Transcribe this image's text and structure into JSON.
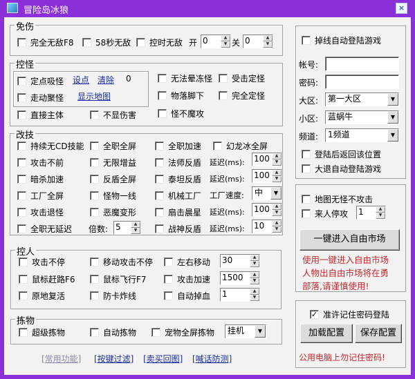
{
  "window": {
    "title": "冒险岛冰狼",
    "close": "×"
  },
  "mianshang": {
    "title": "免伤",
    "wudi": "完全无敌F8",
    "wudi58": "58秒无敌",
    "kongshi": "控时无敌",
    "kai": "开",
    "kai_value": "0",
    "guan": "关",
    "guan_value": "0"
  },
  "kongguai": {
    "title": "控怪",
    "dingdian": "定点吸怪",
    "shedian": "设点",
    "qingchu": "清除",
    "count": "0",
    "zoudong": "走动聚怪",
    "xianshi": "显示地图",
    "zhijie": "直接主体",
    "buxian": "不显伤害",
    "wufa": "无法晕冻怪",
    "shouji": "受击定怪",
    "wuluo": "物落脚下",
    "wanquan": "完全定怪",
    "guaibu": "怪不魔攻"
  },
  "gaiji": {
    "title": "改技",
    "c1": [
      "持续无CD技能",
      "攻击不前",
      "暗杀加速",
      "工厂全屏",
      "攻击退怪",
      "全职无延迟"
    ],
    "c2": [
      "全职全屏",
      "无限增益",
      "反盾全屏",
      "怪物一线",
      "恶魔变形"
    ],
    "beishu": "倍数:",
    "beishu_value": "5",
    "c3": [
      "全职加速",
      "法师反盾",
      "泰坦反盾",
      "机械工厂",
      "扇击晨星",
      "战神反盾"
    ],
    "huanlong": "幻龙冰全屏",
    "delay": "延迟(ms):",
    "factory_speed": "工厂速度:",
    "factory_speed_value": "中",
    "delays": [
      "100",
      "100",
      "100",
      "10"
    ]
  },
  "kongren": {
    "title": "控人",
    "c1": [
      "攻击不停",
      "鼠标赶路F6",
      "原地复活"
    ],
    "c2": [
      "移动攻击不停",
      "鼠标飞行F7",
      "防卡炸线"
    ],
    "c3": [
      "左右移动",
      "攻击加速",
      "自动掉血"
    ],
    "values": [
      "30",
      "1500",
      "1"
    ]
  },
  "jianwu": {
    "title": "拣物",
    "items": [
      "超级拣物",
      "自动拣物",
      "宠物全屏拣物"
    ],
    "mode": "挂机"
  },
  "bottom_links": [
    "[常用功能]",
    "[按键过滤]",
    "[卖买回图]",
    "[喊话防测]"
  ],
  "login": {
    "auto": "掉线自动登陆游戏",
    "account": "帐号:",
    "password": "密码:",
    "account_value": "",
    "password_value": "",
    "daqu": "大区:",
    "daqu_value": "第一大区",
    "xiaoqu": "小区:",
    "xiaoqu_value": "蓝蜗牛",
    "pindao": "频道:",
    "pindao_value": "1频道",
    "fanhui": "登陆后返回该位置",
    "datui": "大退自动登陆游戏"
  },
  "market": {
    "ditu": "地图无怪不攻击",
    "lairen": "来人停攻",
    "lairen_value": "1",
    "button": "一键进入自由市场",
    "warning": [
      "使用一键进入自由市场",
      "人物出自由市场将在勇",
      "部落,请谨慎使用!"
    ]
  },
  "config": {
    "remember": "准许记住密码登陆",
    "load": "加载配置",
    "save": "保存配置",
    "warning": "公用电脑上勿记住密码!",
    "remember_checked": true
  },
  "colors": {
    "titlebar": "#8b2fd9",
    "warning": "#c0282c",
    "link": "#1a2e9c"
  }
}
